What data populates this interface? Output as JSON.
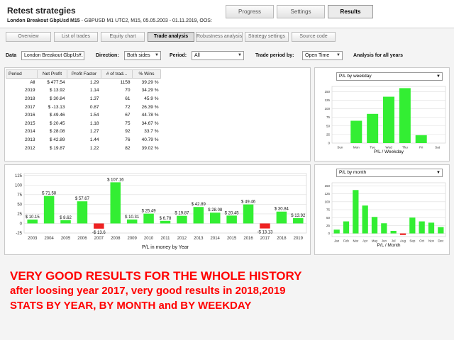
{
  "window": {
    "title": "Retest strategies",
    "subtitle_bold": "London Breakout GbpUsd M15",
    "subtitle_rest": " - GBPUSD  M1  UTC2, M15, 05.05.2003 - 01.11.2019, OOS:"
  },
  "top_tabs": [
    {
      "label": "Progress",
      "active": false
    },
    {
      "label": "Settings",
      "active": false
    },
    {
      "label": "Results",
      "active": true
    }
  ],
  "sub_tabs": [
    {
      "label": "Overview",
      "active": false
    },
    {
      "label": "List of trades",
      "active": false
    },
    {
      "label": "Equity chart",
      "active": false
    },
    {
      "label": "Trade analysis",
      "active": true
    },
    {
      "label": "Robustness analysis",
      "active": false
    },
    {
      "label": "Strategy settings",
      "active": false
    },
    {
      "label": "Source code",
      "active": false
    }
  ],
  "filters": {
    "data_label": "Data",
    "data_value": "London Breakout GbpUs...",
    "direction_label": "Direction:",
    "direction_value": "Both sides",
    "period_label": "Period:",
    "period_value": "All",
    "trade_period_label": "Trade period by:",
    "trade_period_value": "Open Time",
    "analysis_label": "Analysis for all years"
  },
  "stats_table": {
    "headers": [
      "Period",
      "Net Profit",
      "Profit Factor",
      "# of trad...",
      "% Wins"
    ],
    "rows": [
      {
        "period": "All",
        "net_profit": "$ 477.54",
        "pf": "1.29",
        "trades": "1158",
        "wins": "39.29 %",
        "negative": false
      },
      {
        "period": "2019",
        "net_profit": "$ 13.92",
        "pf": "1.14",
        "trades": "70",
        "wins": "34.29 %",
        "negative": false
      },
      {
        "period": "2018",
        "net_profit": "$ 30.84",
        "pf": "1.37",
        "trades": "61",
        "wins": "45.9 %",
        "negative": false
      },
      {
        "period": "2017",
        "net_profit": "$ -13.13",
        "pf": "0.87",
        "trades": "72",
        "wins": "26.39 %",
        "negative": true
      },
      {
        "period": "2016",
        "net_profit": "$ 49.46",
        "pf": "1.54",
        "trades": "67",
        "wins": "44.78 %",
        "negative": false
      },
      {
        "period": "2015",
        "net_profit": "$ 20.45",
        "pf": "1.18",
        "trades": "75",
        "wins": "34.67 %",
        "negative": false
      },
      {
        "period": "2014",
        "net_profit": "$ 28.08",
        "pf": "1.27",
        "trades": "92",
        "wins": "33.7 %",
        "negative": false
      },
      {
        "period": "2013",
        "net_profit": "$ 42.89",
        "pf": "1.44",
        "trades": "76",
        "wins": "40.79 %",
        "negative": false
      },
      {
        "period": "2012",
        "net_profit": "$ 19.87",
        "pf": "1.22",
        "trades": "82",
        "wins": "39.02 %",
        "negative": false
      }
    ]
  },
  "weekday_panel": {
    "select_value": "P/L by weekday"
  },
  "month_panel": {
    "select_value": "P/L by month"
  },
  "overlay_text": {
    "line1": "VERY GOOD RESULTS FOR THE WHOLE HISTORY",
    "line2": "after loosing year 2017, very good results in 2018,2019",
    "line3": "STATS BY YEAR, BY MONTH and BY WEEKDAY"
  },
  "colors": {
    "bar_positive": "#33ee33",
    "bar_negative": "#ee2222",
    "overlay_text": "#ff0000",
    "profit_positive": "#1a1ad0",
    "profit_negative": "#d00000"
  },
  "chart_data": [
    {
      "type": "bar",
      "xlabel": "P/L in money by Year",
      "categories": [
        "2003",
        "2004",
        "2005",
        "2006",
        "2007",
        "2008",
        "2009",
        "2010",
        "2011",
        "2012",
        "2013",
        "2014",
        "2015",
        "2016",
        "2017",
        "2018",
        "2019"
      ],
      "values": [
        10.15,
        71.58,
        8.62,
        57.67,
        -13.6,
        107.16,
        10.31,
        25.49,
        6.78,
        19.87,
        42.89,
        28.08,
        20.45,
        49.46,
        -13.13,
        30.84,
        13.92
      ],
      "data_labels": [
        "$ 10.15",
        "$ 71.58",
        "$ 8.62",
        "$ 57.67",
        "-$ 13.6",
        "$ 107.16",
        "$ 10.31",
        "$ 25.49",
        "$ 6.78",
        "$ 19.87",
        "$ 42.89",
        "$ 28.08",
        "$ 20.45",
        "$ 49.46",
        "-$ 13.13",
        "$ 30.84",
        "$ 13.92"
      ],
      "yticks": [
        -25,
        0,
        25,
        50,
        75,
        100,
        125
      ],
      "ylim": [
        -25,
        130
      ],
      "grid": true
    },
    {
      "type": "bar",
      "xlabel": "P/L / Weekday",
      "categories": [
        "Sun",
        "Mon",
        "Tue",
        "Wed",
        "Thu",
        "Fri",
        "Sat"
      ],
      "values": [
        0,
        65,
        85,
        135,
        160,
        23,
        0
      ],
      "yticks": [
        0,
        25,
        50,
        75,
        100,
        125,
        150
      ],
      "ylim": [
        0,
        165
      ],
      "grid": true
    },
    {
      "type": "bar",
      "xlabel": "P/L / Month",
      "categories": [
        "Jan",
        "Feb",
        "Mar",
        "Apr",
        "May",
        "Jun",
        "Jul",
        "Aug",
        "Sep",
        "Oct",
        "Nov",
        "Dec"
      ],
      "values": [
        12,
        38,
        137,
        88,
        52,
        32,
        8,
        -5,
        50,
        38,
        34,
        20
      ],
      "yticks": [
        0,
        25,
        50,
        75,
        100,
        125,
        150
      ],
      "ylim": [
        -10,
        160
      ],
      "grid": true
    }
  ]
}
